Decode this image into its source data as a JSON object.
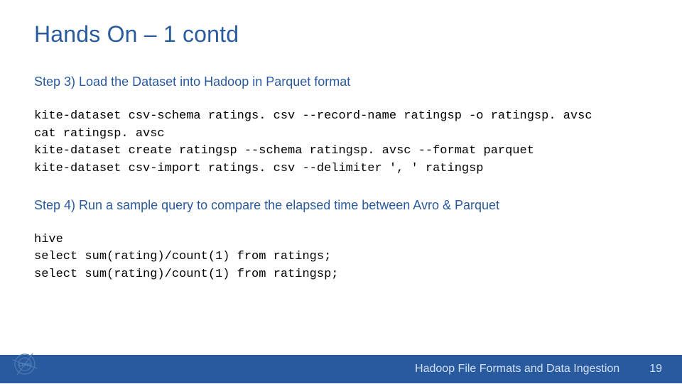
{
  "title": "Hands On – 1 contd",
  "step3": {
    "heading": "Step 3) Load the Dataset into Hadoop in Parquet format",
    "code": "kite-dataset csv-schema ratings. csv --record-name ratingsp -o ratingsp. avsc\ncat ratingsp. avsc\nkite-dataset create ratingsp --schema ratingsp. avsc --format parquet\nkite-dataset csv-import ratings. csv --delimiter ', ' ratingsp"
  },
  "step4": {
    "heading": "Step 4) Run a sample query to compare the elapsed time between Avro & Parquet",
    "code": "hive\nselect sum(rating)/count(1) from ratings;\nselect sum(rating)/count(1) from ratingsp;"
  },
  "footer": {
    "text": "Hadoop File Formats and Data Ingestion",
    "page": "19",
    "logo": "cern-logo"
  }
}
